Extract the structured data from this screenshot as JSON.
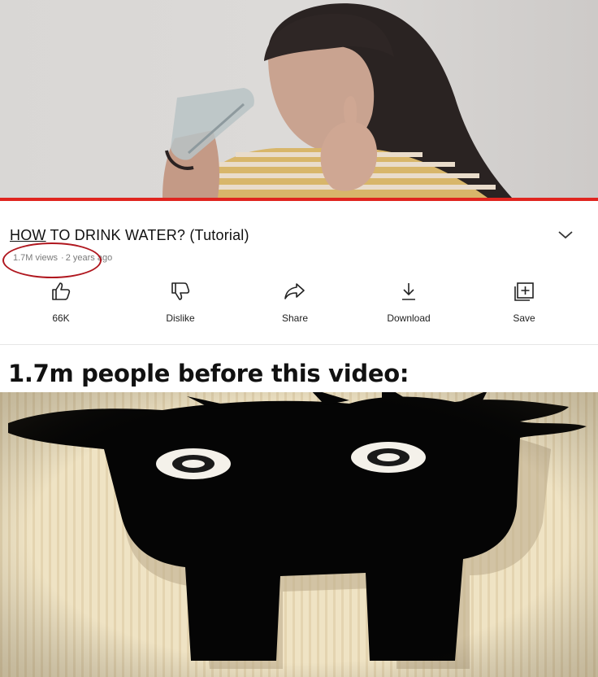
{
  "video": {
    "progress": 1.0
  },
  "info": {
    "title_prefix": "HOW",
    "title_rest": " TO DRINK WATER? (Tutorial)",
    "views": "1.7M views",
    "separator": "·",
    "age": "2 years ago"
  },
  "actions": [
    {
      "label": "66K",
      "icon": "thumbs-up-icon"
    },
    {
      "label": "Dislike",
      "icon": "thumbs-down-icon"
    },
    {
      "label": "Share",
      "icon": "share-arrow-icon"
    },
    {
      "label": "Download",
      "icon": "download-icon"
    },
    {
      "label": "Save",
      "icon": "add-to-playlist-icon"
    }
  ],
  "caption": {
    "text": "1.7m people before this video:"
  },
  "colors": {
    "progress_red": "#e0251f",
    "annotation_circle": "#b0171f",
    "meme_background": "#efe3c4",
    "silhouette": "#000000"
  }
}
